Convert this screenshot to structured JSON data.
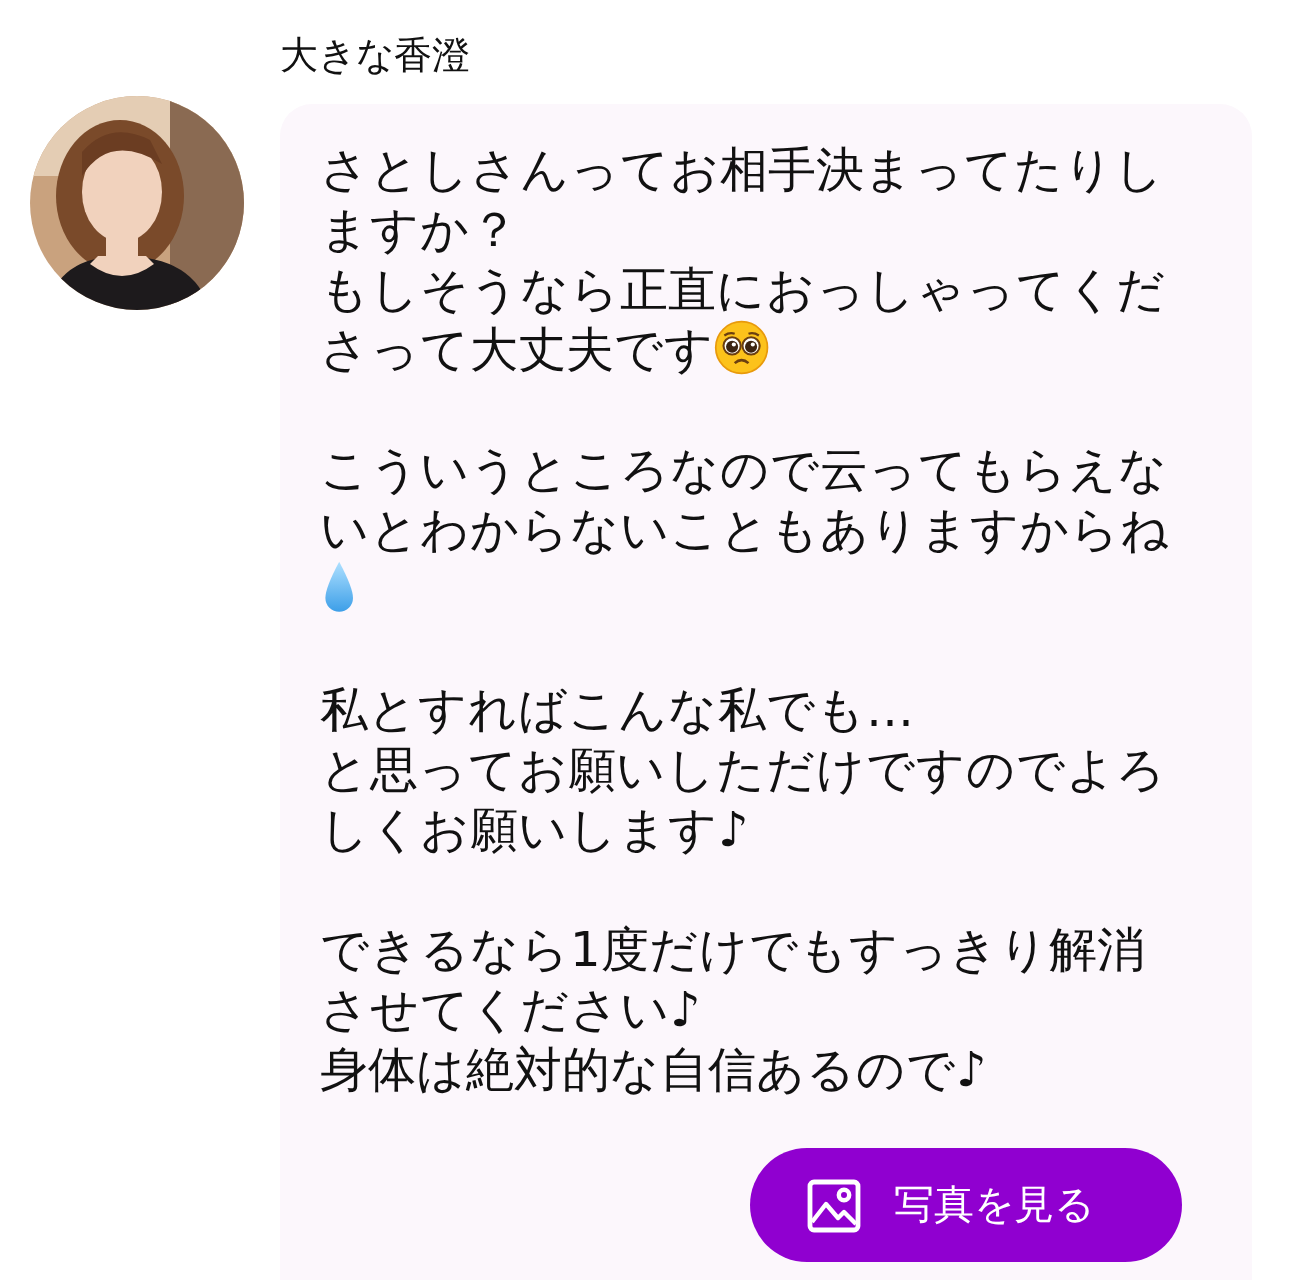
{
  "message": {
    "sender": "大きな香澄",
    "paragraphs": [
      {
        "lines": [
          "さとしさんってお相手決まってたりしますか？",
          "もしそうなら正直におっしゃってくださって大丈夫です"
        ],
        "kind": "pleading"
      },
      {
        "lines": [
          "こういうところなので云ってもらえないとわからないこともありますからね"
        ],
        "kind": "droplet"
      },
      {
        "lines": [
          "私とすればこんな私でも…",
          "と思ってお願いしただけですのでよろしくお願いします♪"
        ],
        "kind": "plain"
      },
      {
        "lines": [
          "できるなら1度だけでもすっきり解消させてください♪",
          "身体は絶対的な自信あるので♪"
        ],
        "kind": "plain"
      }
    ],
    "button": {
      "label": "写真を見る"
    }
  }
}
